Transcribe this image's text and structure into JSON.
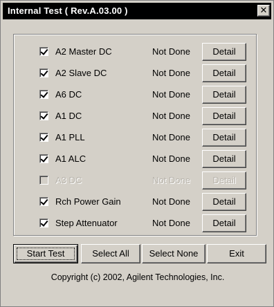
{
  "window": {
    "title": "Internal Test ( Rev.A.03.00 )",
    "close_glyph": "✕"
  },
  "tests": [
    {
      "label": "A2 Master DC",
      "checked": true,
      "enabled": true,
      "status": "Not Done",
      "detail_label": "Detail"
    },
    {
      "label": "A2 Slave DC",
      "checked": true,
      "enabled": true,
      "status": "Not Done",
      "detail_label": "Detail"
    },
    {
      "label": "A6 DC",
      "checked": true,
      "enabled": true,
      "status": "Not Done",
      "detail_label": "Detail"
    },
    {
      "label": "A1 DC",
      "checked": true,
      "enabled": true,
      "status": "Not Done",
      "detail_label": "Detail"
    },
    {
      "label": "A1 PLL",
      "checked": true,
      "enabled": true,
      "status": "Not Done",
      "detail_label": "Detail"
    },
    {
      "label": "A1 ALC",
      "checked": true,
      "enabled": true,
      "status": "Not Done",
      "detail_label": "Detail"
    },
    {
      "label": "A3 DC",
      "checked": false,
      "enabled": false,
      "status": "Not Done",
      "detail_label": "Detail"
    },
    {
      "label": "Rch Power Gain",
      "checked": true,
      "enabled": true,
      "status": "Not Done",
      "detail_label": "Detail"
    },
    {
      "label": "Step Attenuator",
      "checked": true,
      "enabled": true,
      "status": "Not Done",
      "detail_label": "Detail"
    }
  ],
  "buttons": {
    "start_test": "Start Test",
    "select_all": "Select All",
    "select_none": "Select None",
    "exit": "Exit"
  },
  "footer": {
    "copyright": "Copyright (c) 2002, Agilent Technologies, Inc."
  },
  "colors": {
    "titlebar": "#000000",
    "face": "#d4d0c8",
    "disabled_text": "#b8b4ac"
  }
}
